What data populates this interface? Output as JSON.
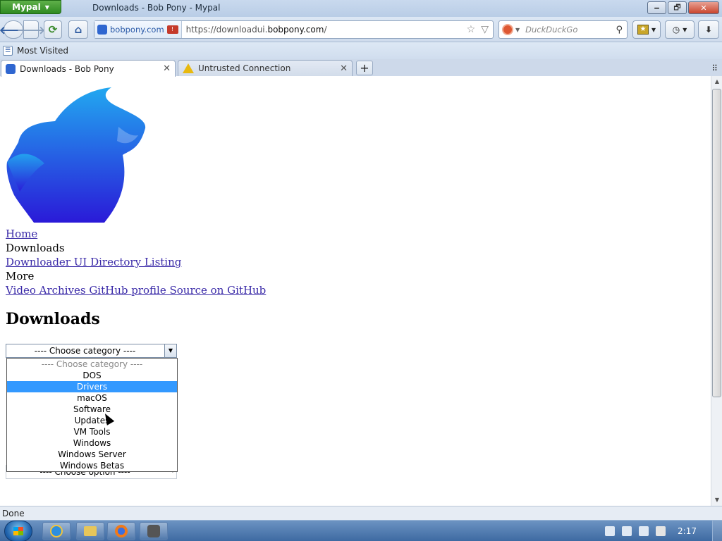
{
  "window": {
    "app_menu": "Mypal",
    "title": "Downloads - Bob Pony - Mypal",
    "minimize": "🗕",
    "restore": "🗗",
    "close": "✕"
  },
  "navbar": {
    "identity_label": "bobpony.com",
    "url_prefix": "https://downloadui.",
    "url_host": "bobpony.com",
    "url_suffix": "/",
    "search_placeholder": "DuckDuckGo"
  },
  "bookmarks": {
    "most_visited": "Most Visited"
  },
  "tabs": [
    {
      "label": "Downloads - Bob Pony",
      "active": true
    },
    {
      "label": "Untrusted Connection",
      "active": false
    }
  ],
  "page": {
    "nav": [
      {
        "text": "Home",
        "link": true
      },
      {
        "text": "Downloads",
        "link": false
      },
      {
        "text": "Downloader UI Directory Listing",
        "link": true
      },
      {
        "text": "More",
        "link": false
      },
      {
        "text": "Video Archives GitHub profile Source on GitHub",
        "link": true
      }
    ],
    "heading": "Downloads",
    "category_select": {
      "value": "---- Choose category ----",
      "options": [
        "---- Choose category ----",
        "DOS",
        "Drivers",
        "macOS",
        "Software",
        "Updates",
        "VM Tools",
        "Windows",
        "Windows Server",
        "Windows Betas"
      ],
      "highlighted": "Drivers"
    },
    "option_select": {
      "value": "---- Choose option ----"
    }
  },
  "status": {
    "text": "Done"
  },
  "taskbar": {
    "clock": "2:17"
  },
  "colors": {
    "highlight": "#3399ff",
    "link": "#3a2aa8",
    "logo_top": "#22a8f0",
    "logo_bottom": "#2a1ad8"
  }
}
